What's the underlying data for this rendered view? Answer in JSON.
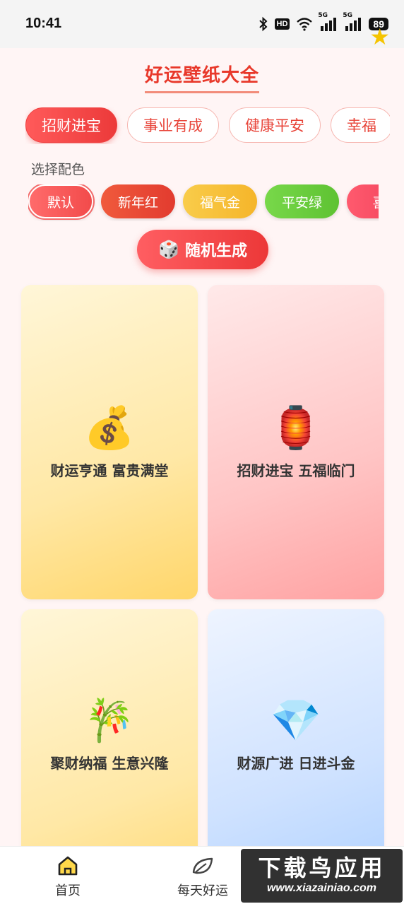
{
  "status_bar": {
    "time": "10:41",
    "hd_label": "HD",
    "signal_label_1": "5G",
    "signal_label_2": "5G",
    "battery": "89",
    "icons": [
      "bluetooth-icon",
      "hd-icon",
      "wifi-icon",
      "signal-5g-icon",
      "signal-5g-icon",
      "battery-icon",
      "star-icon"
    ]
  },
  "header": {
    "title": "好运壁纸大全"
  },
  "tabs": [
    {
      "label": "招财进宝",
      "active": true
    },
    {
      "label": "事业有成",
      "active": false
    },
    {
      "label": "健康平安",
      "active": false
    },
    {
      "label": "幸福",
      "active": false
    }
  ],
  "colors": {
    "label": "选择配色",
    "options": [
      {
        "label": "默认",
        "color": "#ff5b5b"
      },
      {
        "label": "新年红",
        "color": "#ee4b3a"
      },
      {
        "label": "福气金",
        "color": "#f8c23a"
      },
      {
        "label": "平安绿",
        "color": "#6dcf3a"
      },
      {
        "label": "喜",
        "color": "#ff4d6a"
      }
    ]
  },
  "random_button": {
    "icon": "dice-icon",
    "label": "随机生成"
  },
  "cards": [
    {
      "emoji": "💰",
      "icon": "money-bag-icon",
      "text": "财运亨通 富贵满堂"
    },
    {
      "emoji": "🏮",
      "icon": "red-lantern-icon",
      "text": "招财进宝 五福临门"
    },
    {
      "emoji": "🎋",
      "icon": "tanabata-tree-icon",
      "text": "聚财纳福 生意兴隆"
    },
    {
      "emoji": "💎",
      "icon": "gem-icon",
      "text": "财源广进 日进斗金"
    }
  ],
  "bottom_nav": {
    "items": [
      {
        "label": "首页",
        "icon": "home-icon"
      },
      {
        "label": "每天好运",
        "icon": "leaf-icon"
      }
    ]
  },
  "watermark": {
    "title": "下载鸟应用",
    "url": "www.xiazainiao.com"
  },
  "theme": {
    "accent": "#ec3a3a",
    "background": "#fff5f5"
  }
}
